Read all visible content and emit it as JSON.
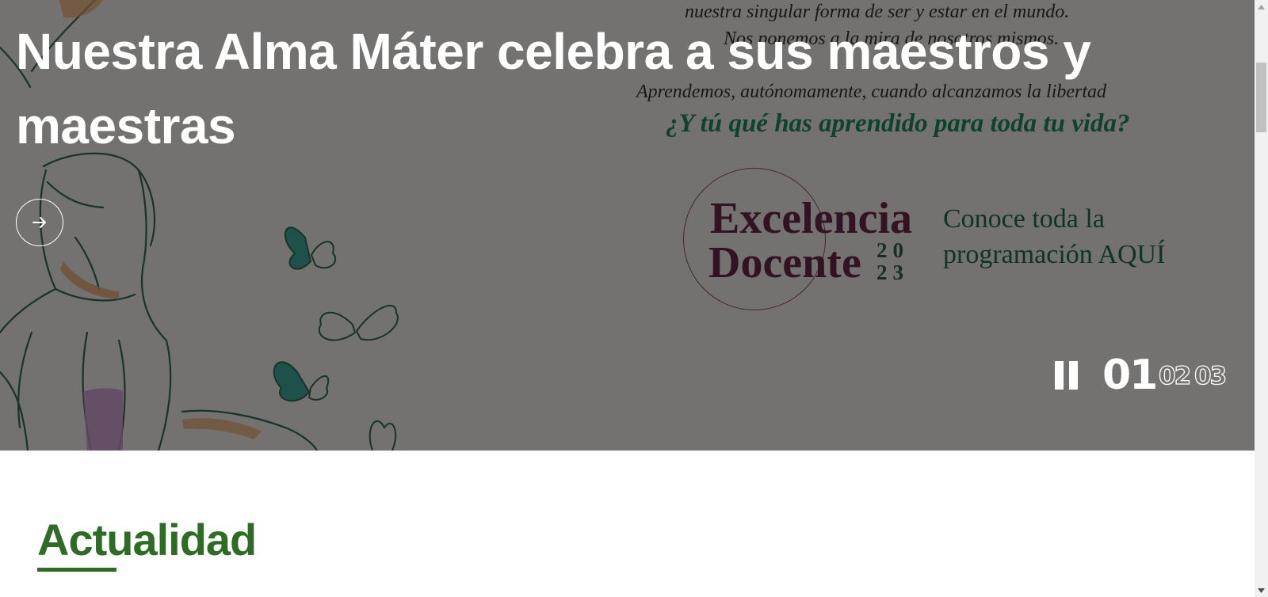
{
  "hero": {
    "title": "Nuestra Alma Máter celebra a sus maestros y maestras",
    "poem_lines": [
      "nuestra singular forma de ser y estar en el mundo.",
      "Nos ponemos a la mira de nosotros mismos.",
      "Aprendemos, autónomamente, cuando alcanzamos la libertad"
    ],
    "question": "¿Y tú qué has aprendido para toda tu vida?",
    "seal": {
      "word1": "Excelencia",
      "word2": "Docente",
      "year_top": "20",
      "year_bottom": "23"
    },
    "cta": "Conoce toda la programación AQUÍ",
    "next_icon": "arrow-right-icon",
    "slider": {
      "pause_icon": "pause-icon",
      "slides": [
        "01",
        "02",
        "03"
      ],
      "active_index": 0
    },
    "colors": {
      "question": "#0a7a45",
      "seal_text": "#5a1235",
      "cta": "#0d5a3a"
    }
  },
  "main": {
    "section_title": "Actualidad",
    "accent_color": "#2e6b25"
  },
  "scrollbar": {
    "up_icon": "scroll-up-arrow-icon",
    "down_icon": "scroll-down-arrow-icon"
  }
}
